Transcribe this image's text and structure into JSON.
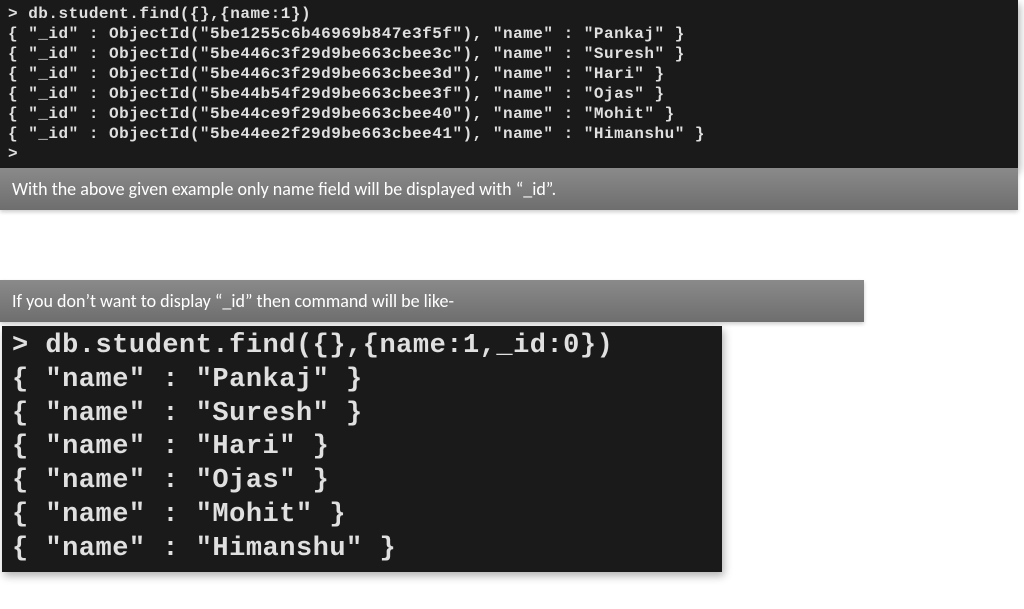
{
  "terminal1": {
    "command": "> db.student.find({},{name:1})",
    "rows": [
      "{ \"_id\" : ObjectId(\"5be1255c6b46969b847e3f5f\"), \"name\" : \"Pankaj\" }",
      "{ \"_id\" : ObjectId(\"5be446c3f29d9be663cbee3c\"), \"name\" : \"Suresh\" }",
      "{ \"_id\" : ObjectId(\"5be446c3f29d9be663cbee3d\"), \"name\" : \"Hari\" }",
      "{ \"_id\" : ObjectId(\"5be44b54f29d9be663cbee3f\"), \"name\" : \"Ojas\" }",
      "{ \"_id\" : ObjectId(\"5be44ce9f29d9be663cbee40\"), \"name\" : \"Mohit\" }",
      "{ \"_id\" : ObjectId(\"5be44ee2f29d9be663cbee41\"), \"name\" : \"Himanshu\" }"
    ],
    "prompt": ">"
  },
  "caption1": "With the above given example only name field will be displayed with “_id”.",
  "caption2": "If you don’t want to display  “_id” then command will be like-",
  "terminal2": {
    "command": "> db.student.find({},{name:1,_id:0})",
    "rows": [
      "{ \"name\" : \"Pankaj\" }",
      "{ \"name\" : \"Suresh\" }",
      "{ \"name\" : \"Hari\" }",
      "{ \"name\" : \"Ojas\" }",
      "{ \"name\" : \"Mohit\" }",
      "{ \"name\" : \"Himanshu\" }"
    ]
  }
}
